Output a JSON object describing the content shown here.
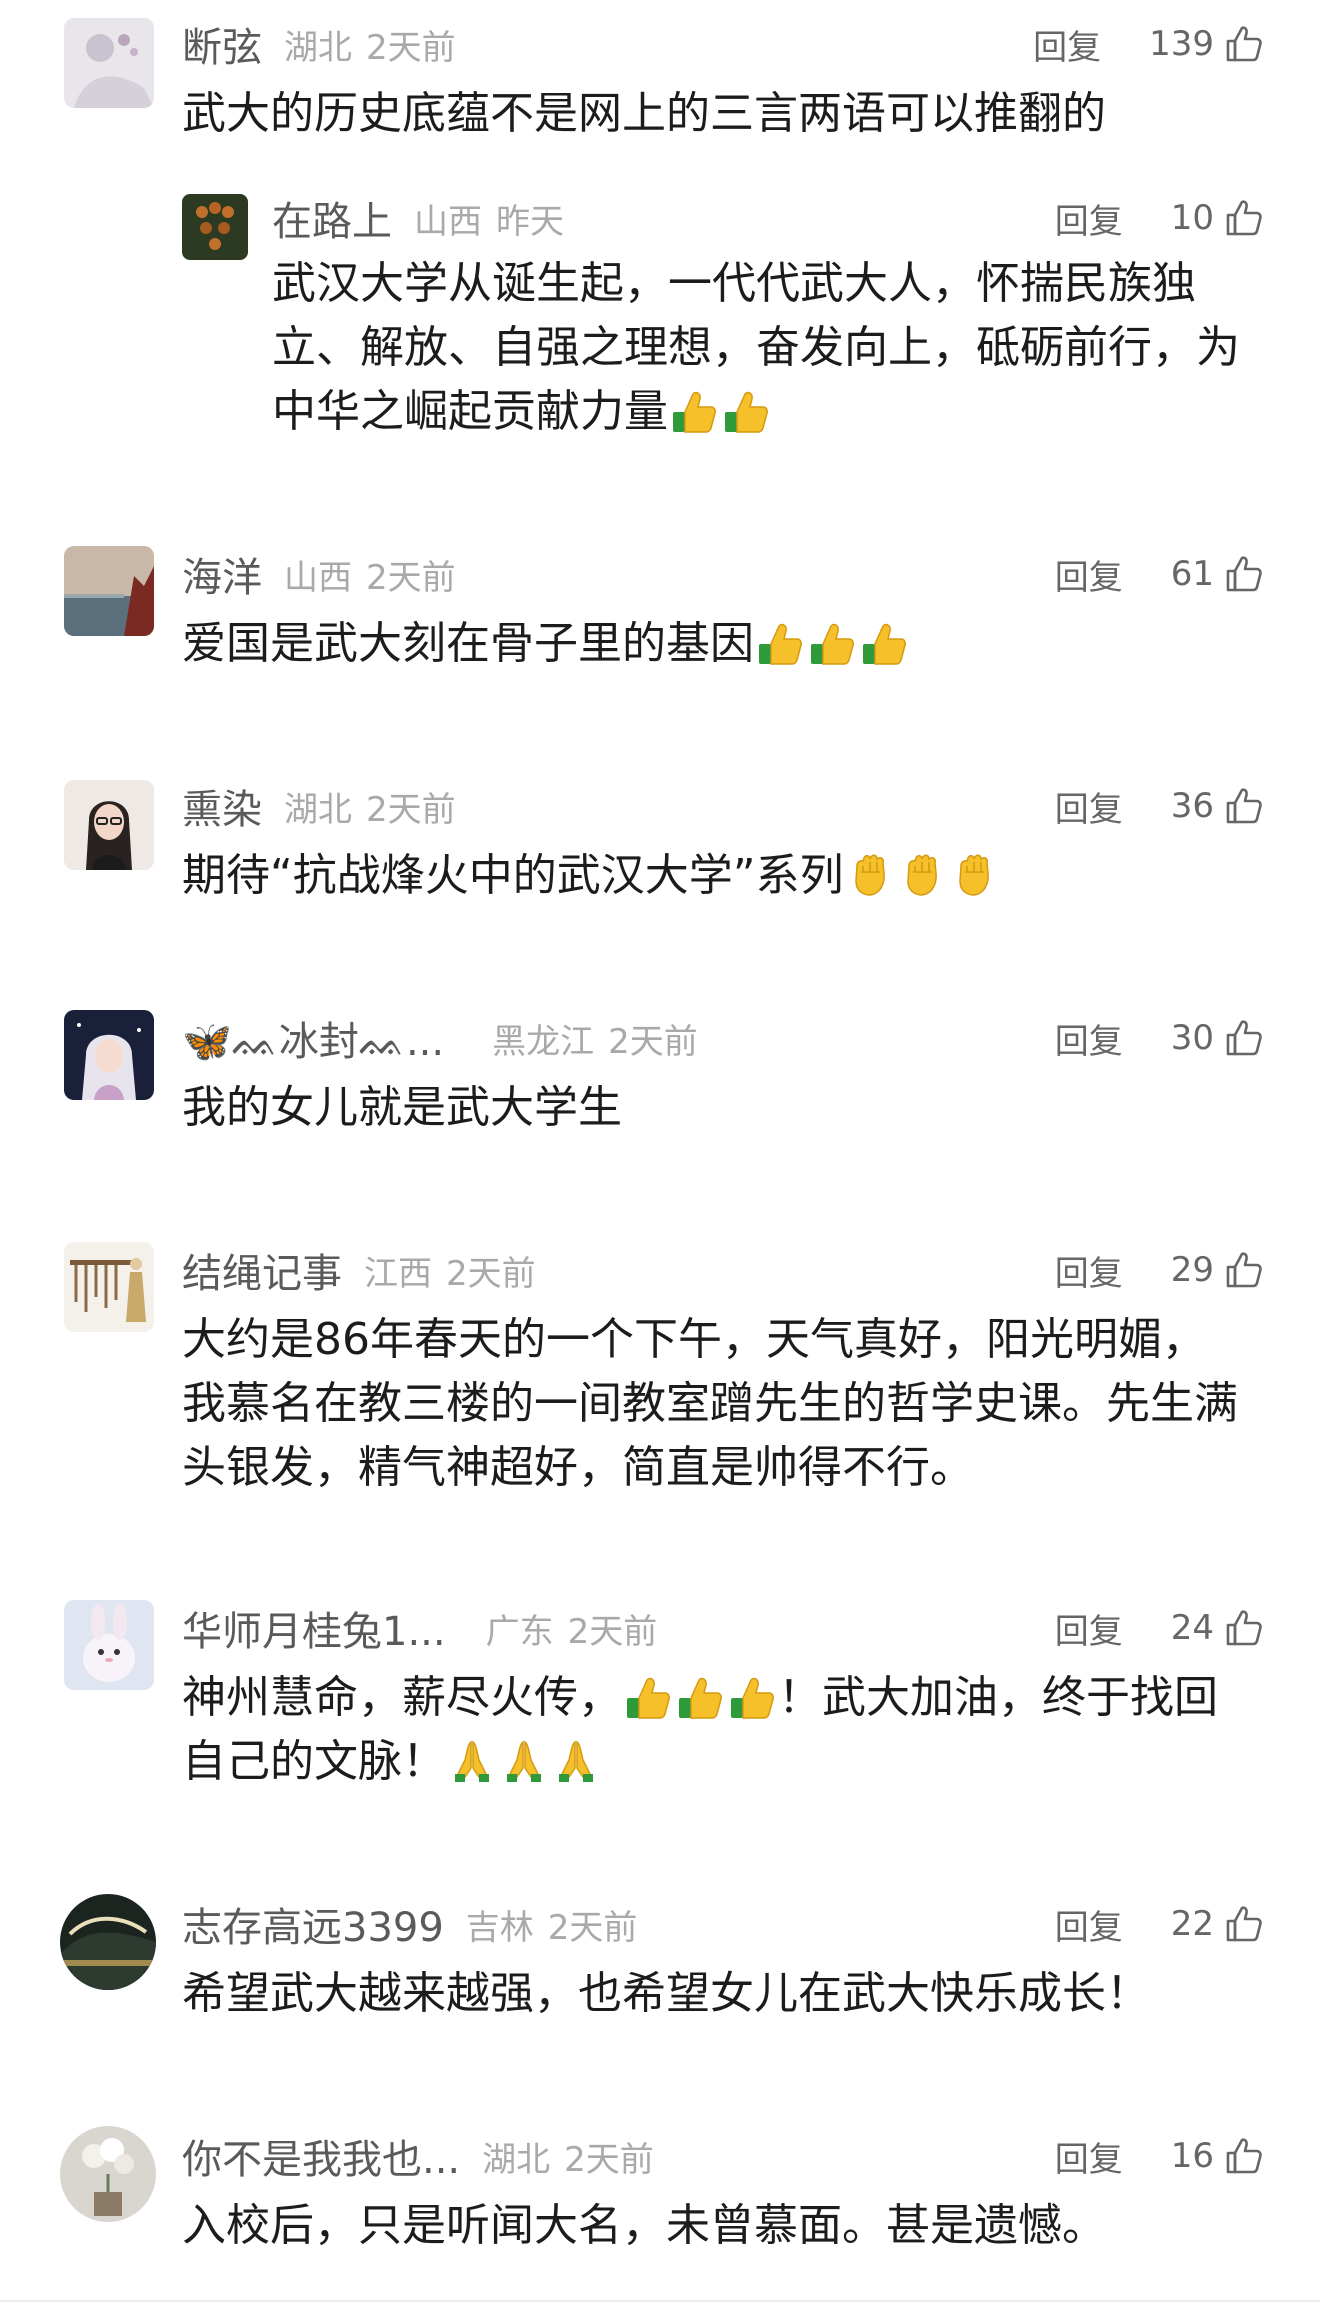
{
  "comments": [
    {
      "name": "断弦",
      "location": "湖北",
      "time": "2天前",
      "reply": "回复",
      "likes": "139",
      "text": "武大的历史底蕴不是网上的三言两语可以推翻的"
    },
    {
      "name": "在路上",
      "location": "山西",
      "time": "昨天",
      "reply": "回复",
      "likes": "10",
      "text_lines": [
        "武汉大学从诞生起，一代代武大人，怀揣民族独",
        "立、解放、自强之理想，奋发向上，砥砺前行，为",
        "中华之崛起贡献力量"
      ]
    },
    {
      "name": "海洋",
      "location": "山西",
      "time": "2天前",
      "reply": "回复",
      "likes": "61",
      "text": "爱国是武大刻在骨子里的基因"
    },
    {
      "name": "熏染",
      "location": "湖北",
      "time": "2天前",
      "reply": "回复",
      "likes": "36",
      "text": "期待“抗战烽火中的武汉大学”系列"
    },
    {
      "name": "ᨐ冰封ᨐ...",
      "location": "黑龙江",
      "time": "2天前",
      "reply": "回复",
      "likes": "30",
      "text": "我的女儿就是武大学生"
    },
    {
      "name": "结绳记事",
      "location": "江西",
      "time": "2天前",
      "reply": "回复",
      "likes": "29",
      "text_lines": [
        "大约是86年春天的一个下午，天气真好，阳光明媚，",
        "我慕名在教三楼的一间教室蹭先生的哲学史课。先生满",
        "头银发，精气神超好，简直是帅得不行。"
      ]
    },
    {
      "name": "华师月桂兔1...",
      "location": "广东",
      "time": "2天前",
      "reply": "回复",
      "likes": "24",
      "text_a": "神州慧命，薪尽火传，",
      "text_b": "！武大加油，终于找回",
      "text_c": "自己的文脉！"
    },
    {
      "name": "志存高远3399",
      "location": "吉林",
      "time": "2天前",
      "reply": "回复",
      "likes": "22",
      "text": "希望武大越来越强，也希望女儿在武大快乐成长！"
    },
    {
      "name": "你不是我我也...",
      "location": "湖北",
      "time": "2天前",
      "reply": "回复",
      "likes": "16",
      "text": "入校后，只是听闻大名，未曾慕面。甚是遗憾。"
    }
  ],
  "icons": {
    "like": "thumbs-up-outline-icon",
    "thumbs_emoji": "thumbs-up-emoji",
    "fist_emoji": "raised-fist-emoji",
    "pray_emoji": "folded-hands-emoji"
  },
  "colors": {
    "name": "#5a5a5a",
    "meta": "#a9a9a9",
    "text": "#1c1c1c",
    "emoji_yellow": "#f5c02a",
    "emoji_green": "#2f9a3a"
  }
}
